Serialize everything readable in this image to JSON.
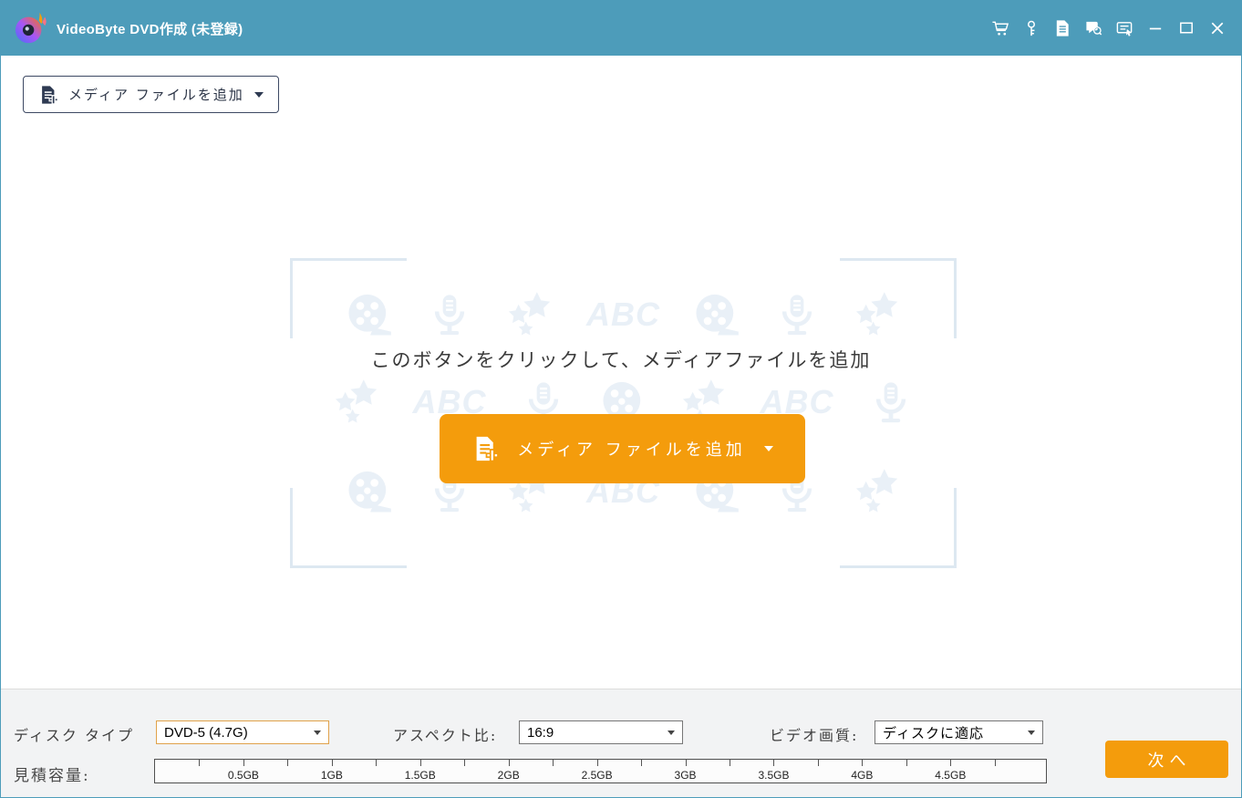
{
  "titlebar": {
    "title": "VideoByte DVD作成 (未登録)",
    "icons": [
      "cart",
      "key",
      "register",
      "feedback",
      "checklist",
      "minimize",
      "maximize",
      "close"
    ]
  },
  "toolbar": {
    "add_media_label": "メディア ファイルを追加"
  },
  "empty_state": {
    "hint": "このボタンをクリックして、メディアファイルを追加",
    "add_media_label": "メディア ファイルを追加",
    "watermark": {
      "abc_text": "ABC",
      "rows": [
        [
          "reel",
          "mic",
          "stars",
          "abc",
          "reel",
          "mic",
          "stars"
        ],
        [
          "stars",
          "abc",
          "mic",
          "reel",
          "stars",
          "abc",
          "mic"
        ],
        [
          "reel",
          "mic",
          "stars",
          "abc",
          "reel",
          "mic",
          "stars"
        ]
      ]
    }
  },
  "bottom_bar": {
    "disc_type_label": "ディスク タイプ",
    "disc_type_value": "DVD-5 (4.7G)",
    "aspect_label": "アスペクト比:",
    "aspect_value": "16:9",
    "quality_label": "ビデオ画質:",
    "quality_value": "ディスクに適応",
    "capacity_label": "見積容量:",
    "next_label": "次へ",
    "capacity_ruler": {
      "max_gb": 5.04,
      "tick_step_gb": 0.25,
      "label_step_gb": 0.5,
      "labels": [
        "0.5GB",
        "1GB",
        "1.5GB",
        "2GB",
        "2.5GB",
        "3GB",
        "3.5GB",
        "4GB",
        "4.5GB"
      ]
    }
  },
  "colors": {
    "titlebar": "#4d9cba",
    "accent": "#f49c0c",
    "watermark": "#e9f0f7",
    "panel": "#f2f3f4"
  }
}
